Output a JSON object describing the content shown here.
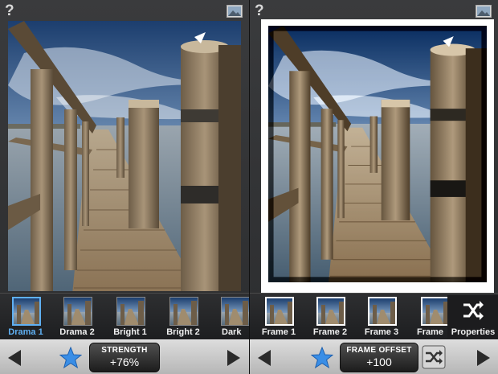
{
  "left_panel": {
    "filters": [
      {
        "label": "Drama 1",
        "selected": true
      },
      {
        "label": "Drama 2",
        "selected": false
      },
      {
        "label": "Bright 1",
        "selected": false
      },
      {
        "label": "Bright 2",
        "selected": false
      },
      {
        "label": "Dark",
        "selected": false
      }
    ],
    "param": {
      "label": "STRENGTH",
      "value": "+76%"
    }
  },
  "right_panel": {
    "frames": [
      {
        "label": "Frame 1"
      },
      {
        "label": "Frame 2"
      },
      {
        "label": "Frame 3"
      },
      {
        "label": "Frame"
      }
    ],
    "properties_label": "Properties",
    "param": {
      "label": "FRAME OFFSET",
      "value": "+100"
    }
  },
  "icons": {
    "help": "?",
    "image": "image-icon",
    "star": "star-icon",
    "shuffle": "shuffle-icon",
    "prev": "left-arrow-icon",
    "next": "right-arrow-icon"
  },
  "colors": {
    "accent": "#5fb0f3",
    "star": "#3a8ee6"
  }
}
